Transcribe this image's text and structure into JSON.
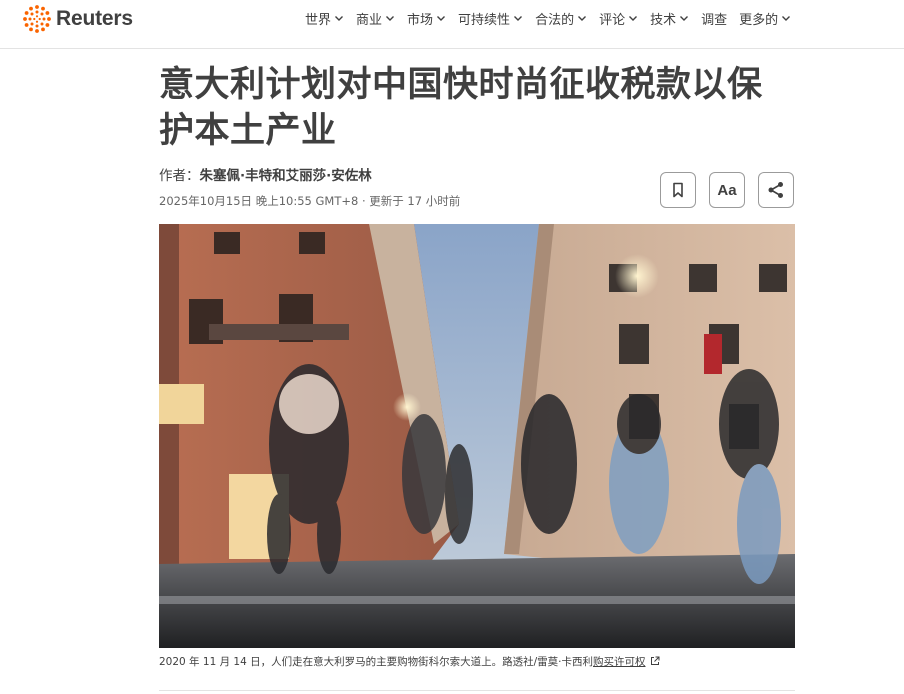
{
  "brand": {
    "name": "Reuters"
  },
  "nav": {
    "items": [
      {
        "label": "世界",
        "has_menu": true
      },
      {
        "label": "商业",
        "has_menu": true
      },
      {
        "label": "市场",
        "has_menu": true
      },
      {
        "label": "可持续性",
        "has_menu": true
      },
      {
        "label": "合法的",
        "has_menu": true
      },
      {
        "label": "评论",
        "has_menu": true
      },
      {
        "label": "技术",
        "has_menu": true
      },
      {
        "label": "调查",
        "has_menu": false
      },
      {
        "label": "更多的",
        "has_menu": true
      }
    ]
  },
  "article": {
    "headline": "意大利计划对中国快时尚征收税款以保护本土产业",
    "byline_prefix": "作者：",
    "authors": "朱塞佩·丰特和艾丽莎·安佐林",
    "dateline": "2025年10月15日 晚上10:55 GMT+8 · 更新于 17 小时前",
    "tools": {
      "font_label": "Aa"
    },
    "photo_caption": "2020 年 11 月 14 日，人们走在意大利罗马的主要购物街科尔索大道上。路透社/雷莫·卡西利",
    "license_link": "购买许可权"
  },
  "icons": {
    "logo": "reuters-dot-ring-icon",
    "bookmark": "bookmark-icon",
    "share": "share-icon",
    "external": "external-link-icon",
    "chevron": "chevron-down-icon"
  },
  "colors": {
    "brand_orange": "#fa6400",
    "text": "#404040"
  }
}
